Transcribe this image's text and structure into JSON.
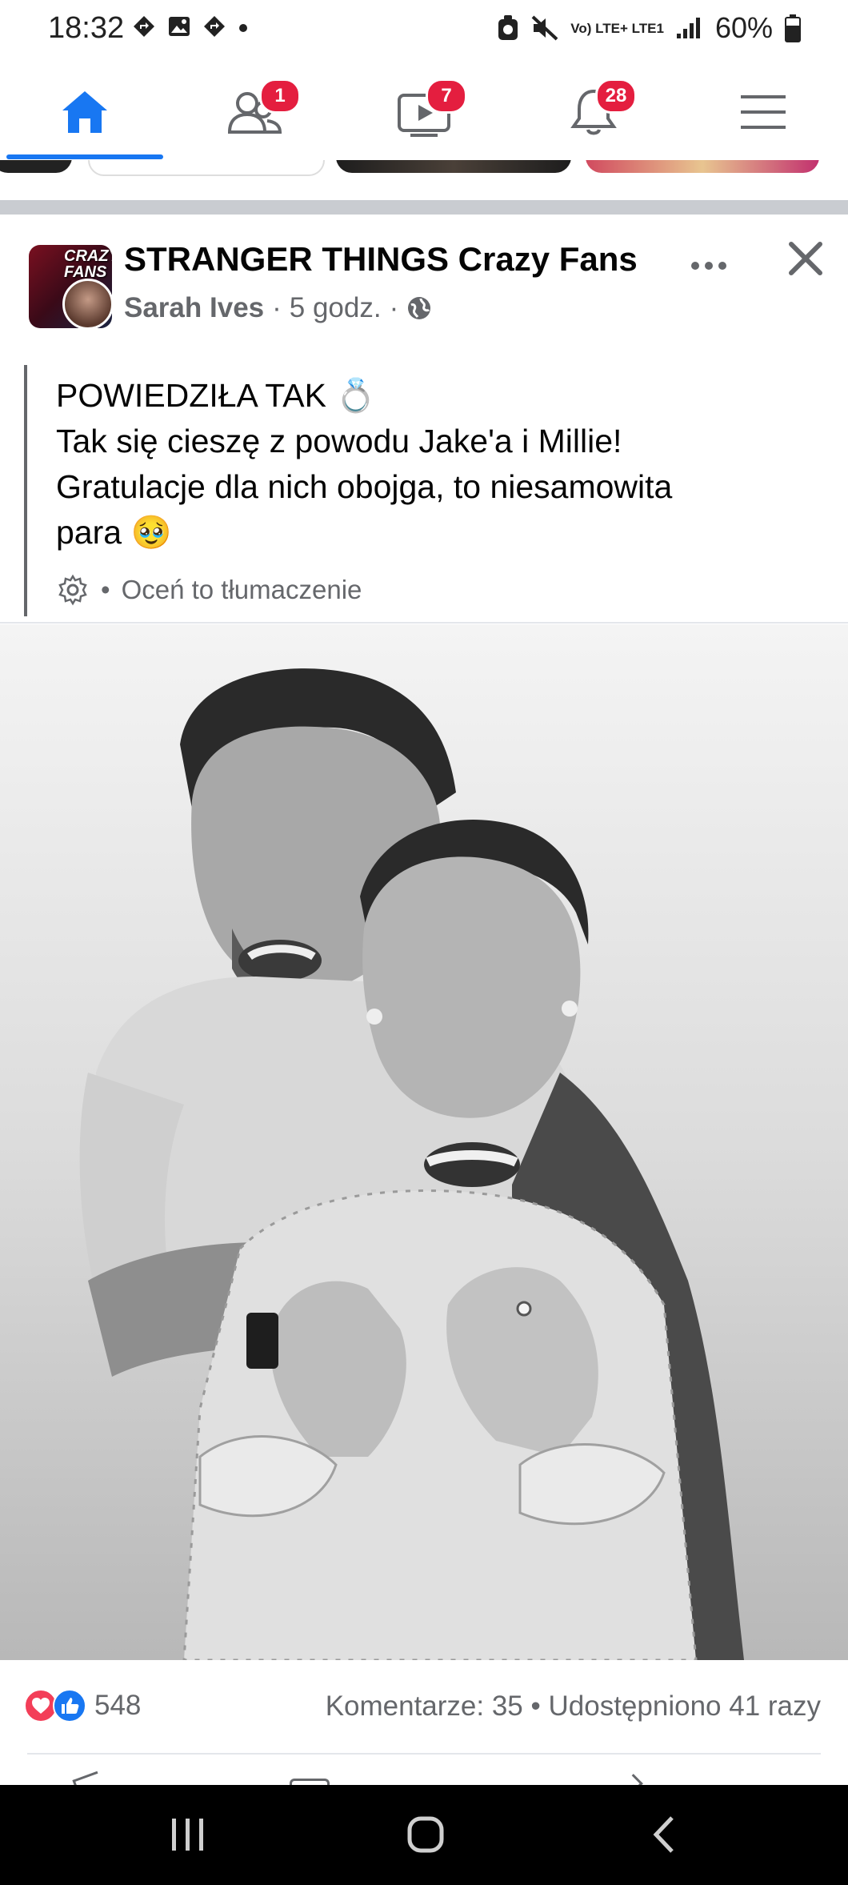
{
  "status_bar": {
    "time": "18:32",
    "left_icons": [
      "navigation-icon",
      "image-icon",
      "navigation-icon",
      "dot-icon"
    ],
    "network": "Vo) LTE+ LTE1",
    "battery": "60%"
  },
  "nav": {
    "items": [
      {
        "name": "home",
        "badge": ""
      },
      {
        "name": "friends",
        "badge": "1"
      },
      {
        "name": "watch",
        "badge": "7"
      },
      {
        "name": "notifications",
        "badge": "28"
      },
      {
        "name": "menu",
        "badge": ""
      }
    ],
    "active": "home"
  },
  "post": {
    "page_name": "STRANGER THINGS Crazy Fans",
    "avatar_text": "CRAZY FANS",
    "author": "Sarah Ives",
    "time": "5 godz.",
    "visibility_icon": "globe-icon",
    "more_icon": "more-icon",
    "close_icon": "close-icon",
    "lines": [
      "POWIEDZIŁA TAK 💍",
      "Tak się cieszę z powodu Jake'a i Millie!",
      "Gratulacje dla nich obojga, to niesamowita",
      "para 🥹"
    ],
    "translate_label": "Oceń to tłumaczenie",
    "reaction_count": "548",
    "comments": "Komentarze: 35",
    "shares": "Udostępniono 41 razy"
  },
  "colors": {
    "accent": "#1877f2",
    "badge": "#e41e3f",
    "secondary_text": "#65676b"
  }
}
